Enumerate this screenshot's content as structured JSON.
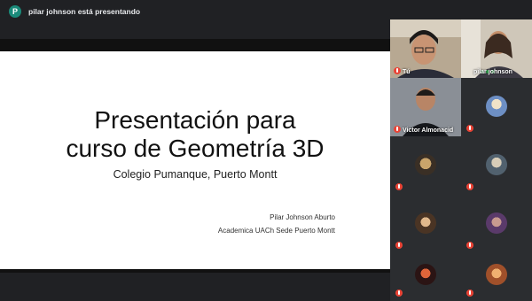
{
  "top_bar": {
    "presenter_initial": "P",
    "presenter_text": "pilar johnson está presentando"
  },
  "slide": {
    "title_line1": "Presentación para",
    "title_line2": "curso de Geometría 3D",
    "subtitle": "Colegio Pumanque, Puerto Montt",
    "author": "Pilar Johnson Aburto",
    "affiliation": "Academica UACh Sede Puerto Montt"
  },
  "participants": [
    {
      "name": "Tú",
      "video": true
    },
    {
      "name": "pilar johnson",
      "video": true
    },
    {
      "name": "Victor Almonacid",
      "video": true
    },
    {
      "name": "",
      "video": false
    },
    {
      "name": "",
      "video": false
    },
    {
      "name": "",
      "video": false
    },
    {
      "name": "",
      "video": false
    },
    {
      "name": "",
      "video": false
    },
    {
      "name": "",
      "video": false
    },
    {
      "name": "",
      "video": false
    }
  ],
  "colors": {
    "background": "#202124",
    "mic_off": "#ea4335",
    "presenter_badge": "#1a8a7a"
  }
}
